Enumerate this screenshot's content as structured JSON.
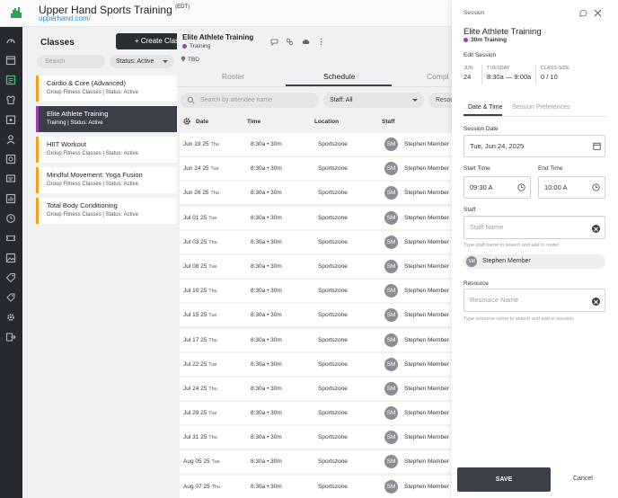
{
  "header": {
    "app_title": "Upper Hand Sports Training",
    "timezone": "(EDT)",
    "url": "upperhand.com/"
  },
  "nav_icons": [
    "dashboard-icon",
    "calendar-icon",
    "classes-icon",
    "team-icon",
    "events-icon",
    "clients-icon",
    "store-icon",
    "messages-icon",
    "reports-icon",
    "memberships-icon",
    "passes-icon",
    "gallery-icon",
    "tags-icon",
    "coupons-icon",
    "settings-icon",
    "logout-icon"
  ],
  "classes": {
    "title": "Classes",
    "create_label": "+ Create Class",
    "search_placeholder": "Search",
    "status_filter": "Status: Active",
    "items": [
      {
        "name": "Cardio & Core (Advanced)",
        "meta": "Group Fitness Classes | Status: Active"
      },
      {
        "name": "Elite Athlete Training",
        "meta": "Training | Status: Active"
      },
      {
        "name": "HIIT Workout",
        "meta": "Group Fitness Classes | Status: Active"
      },
      {
        "name": "Mindful Movement: Yoga Fusion",
        "meta": "Group Fitness Classes | Status: Active"
      },
      {
        "name": "Total Body Conditioning",
        "meta": "Group Fitness Classes | Status: Active"
      }
    ]
  },
  "event": {
    "title": "Elite Athlete Training",
    "type": "Training",
    "location": "TBD",
    "tabs": [
      "Roster",
      "Schedule",
      "Compl"
    ],
    "attendee_search_placeholder": "Search by attendee name",
    "staff_filter": "Staff: All",
    "resource_filter": "Resou",
    "columns": {
      "date": "Date",
      "time": "Time",
      "location": "Location",
      "staff": "Staff"
    },
    "rows": [
      {
        "date": "Jun 19 25",
        "dow": "Thu",
        "time": "8:30a • 30m",
        "location": "Sportszone",
        "initials": "SM",
        "staff": "Stephen Member"
      },
      {
        "date": "Jun 24 25",
        "dow": "Tue",
        "time": "8:30a • 30m",
        "location": "Sportszone",
        "initials": "SM",
        "staff": "Stephen Member"
      },
      {
        "date": "Jun 26 25",
        "dow": "Thu",
        "time": "8:30a • 30m",
        "location": "Sportszone",
        "initials": "SM",
        "staff": "Stephen Member"
      },
      {
        "date": "Jul 01 25",
        "dow": "Tue",
        "time": "8:30a • 30m",
        "location": "Sportszone",
        "initials": "SM",
        "staff": "Stephen Member"
      },
      {
        "date": "Jul 03 25",
        "dow": "Thu",
        "time": "8:30a • 30m",
        "location": "Sportszone",
        "initials": "SM",
        "staff": "Stephen Member"
      },
      {
        "date": "Jul 08 25",
        "dow": "Tue",
        "time": "8:30a • 30m",
        "location": "Sportszone",
        "initials": "SM",
        "staff": "Stephen Member"
      },
      {
        "date": "Jul 10 25",
        "dow": "Thu",
        "time": "8:30a • 30m",
        "location": "Sportszone",
        "initials": "SM",
        "staff": "Stephen Member"
      },
      {
        "date": "Jul 15 25",
        "dow": "Tue",
        "time": "8:30a • 30m",
        "location": "Sportszone",
        "initials": "SM",
        "staff": "Stephen Member"
      },
      {
        "date": "Jul 17 25",
        "dow": "Thu",
        "time": "8:30a • 30m",
        "location": "Sportszone",
        "initials": "SM",
        "staff": "Stephen Member"
      },
      {
        "date": "Jul 22 25",
        "dow": "Tue",
        "time": "8:30a • 30m",
        "location": "Sportszone",
        "initials": "SM",
        "staff": "Stephen Member"
      },
      {
        "date": "Jul 24 25",
        "dow": "Thu",
        "time": "8:30a • 30m",
        "location": "Sportszone",
        "initials": "SM",
        "staff": "Stephen Member"
      },
      {
        "date": "Jul 29 25",
        "dow": "Tue",
        "time": "8:30a • 30m",
        "location": "Sportszone",
        "initials": "SM",
        "staff": "Stephen Member"
      },
      {
        "date": "Jul 31 25",
        "dow": "Thu",
        "time": "8:30a • 30m",
        "location": "Sportszone",
        "initials": "SM",
        "staff": "Stephen Member"
      },
      {
        "date": "Aug 05 25",
        "dow": "Tue",
        "time": "8:30a • 30m",
        "location": "Sportszone",
        "initials": "SM",
        "staff": "Stephen Member"
      },
      {
        "date": "Aug 07 25",
        "dow": "Thu",
        "time": "8:30a • 30m",
        "location": "Sportszone",
        "initials": "SM",
        "staff": "Stephen Member"
      }
    ]
  },
  "drawer": {
    "label": "Session",
    "title": "Elite Athlete Training",
    "subtitle": "30m Training",
    "edit_label": "Edit Session",
    "month": "JUN",
    "day": "24",
    "weekday": "TUESDAY",
    "time_range": "8:30a — 9:00a",
    "class_size_label": "CLASS SIZE",
    "class_size": "0 / 10",
    "tabs": [
      "Date & Time",
      "Session Preferences"
    ],
    "session_date_label": "Session Date",
    "session_date": "Tue, Jun 24, 2025",
    "start_time_label": "Start Time",
    "start_time": "09:30 A",
    "end_time_label": "End Time",
    "end_time": "10:00 A",
    "staff_label": "Staff",
    "staff_placeholder": "Staff Name",
    "staff_hint": "Type staff name to search and add to roster.",
    "staff_chip_initials": "SM",
    "staff_chip_name": "Stephen Member",
    "resource_label": "Resource",
    "resource_placeholder": "Resource Name",
    "resource_hint": "Type resource name to search and add to session.",
    "save_label": "SAVE",
    "cancel_label": "Cancel"
  },
  "colors": {
    "accent_orange": "#f0a21b",
    "accent_purple": "#9c3fae",
    "brand_green": "#2e9e5b",
    "dark": "#3b3f47"
  }
}
